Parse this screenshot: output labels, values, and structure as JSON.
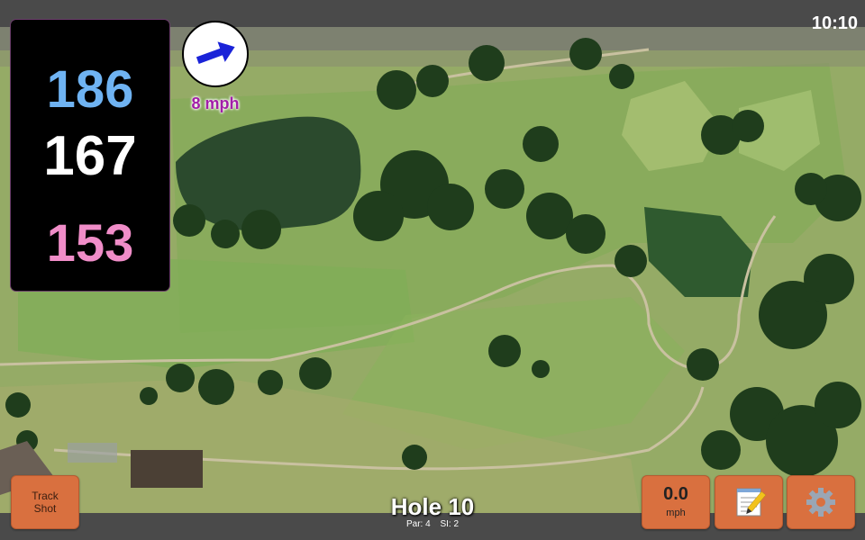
{
  "status": {
    "time": "10:10"
  },
  "yardages": {
    "back": "186",
    "middle": "167",
    "front": "153"
  },
  "wind": {
    "speed_label": "8 mph",
    "direction_deg": 20
  },
  "buttons": {
    "track_shot_line1": "Track",
    "track_shot_line2": "Shot",
    "speed_value": "0.0",
    "speed_unit": "mph"
  },
  "hole": {
    "title": "Hole 10",
    "par": "Par: 4",
    "si": "SI: 2"
  },
  "colors": {
    "back_yardage": "#6fb3f2",
    "middle_yardage": "#ffffff",
    "front_yardage": "#f08dc8",
    "button": "#d9703f",
    "wind_arrow": "#1a23d8",
    "wind_text": "#a21ea8"
  },
  "icons": {
    "notes": "notepad-icon",
    "settings": "gear-icon",
    "wind": "wind-arrow-icon"
  }
}
